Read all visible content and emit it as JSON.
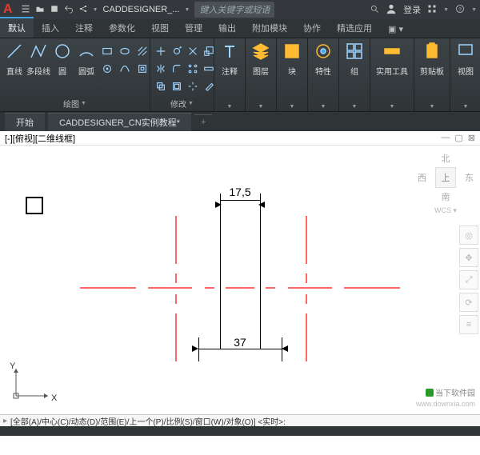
{
  "titlebar": {
    "brand": "A",
    "title": "CADDESIGNER_...",
    "search_placeholder": "键入关键字或短语",
    "login": "登录"
  },
  "ribbon_tabs": [
    "默认",
    "插入",
    "注释",
    "参数化",
    "视图",
    "管理",
    "输出",
    "附加模块",
    "协作",
    "精选应用"
  ],
  "active_tab": 0,
  "panels": {
    "draw": {
      "title": "绘图",
      "line": "直线",
      "polyline": "多段线",
      "circle": "圆",
      "arc": "圆弧"
    },
    "modify": {
      "title": "修改"
    },
    "annotation": {
      "title": "注释",
      "label": "注释"
    },
    "layers": {
      "title": "图层",
      "label": "图层"
    },
    "blocks": {
      "title": "块",
      "label": "块"
    },
    "properties": {
      "title": "特性",
      "label": "特性"
    },
    "groups": {
      "title": "组",
      "label": "组"
    },
    "utils": {
      "title": "实用工具",
      "label": "实用工具"
    },
    "clipboard": {
      "title": "剪贴板",
      "label": "剪贴板"
    },
    "view": {
      "title": "视图",
      "label": "视图"
    }
  },
  "file_tabs": {
    "start": "开始",
    "doc": "CADDESIGNER_CN实例教程*",
    "add": "+"
  },
  "view_header": "[-][俯视][二维线框]",
  "viewcube": {
    "n": "北",
    "s": "南",
    "e": "东",
    "w": "西",
    "top": "上",
    "wcs": "WCS"
  },
  "dims": {
    "top": "17,5",
    "bottom": "37"
  },
  "ucs": {
    "x": "X",
    "y": "Y"
  },
  "command": {
    "prompt": "▸",
    "text": "[全部(A)/中心(C)/动态(D)/范围(E)/上一个(P)/比例(S)/窗口(W)/对象(O)] <实时>:"
  },
  "watermark": {
    "text": "当下软件园",
    "url": "www.downxia.com"
  }
}
